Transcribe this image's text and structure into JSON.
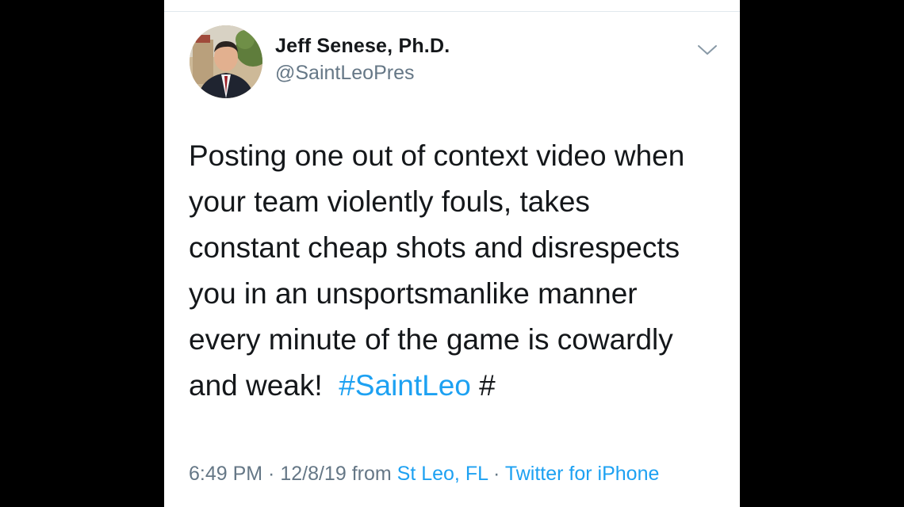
{
  "tweet": {
    "author": {
      "display_name": "Jeff Senese, Ph.D.",
      "handle": "@SaintLeoPres",
      "avatar_icon": "profile-photo"
    },
    "menu_icon": "chevron-down-icon",
    "text_lines": [
      "Posting one out of context video when",
      "your team violently fouls, takes",
      "constant cheap shots and disrespects",
      "you in an unsportsmanlike manner",
      "every minute of the game is cowardly"
    ],
    "last_line": {
      "text": "and weak!  ",
      "hashtag_1": "#SaintLeo",
      "hashtag_2": " #"
    },
    "meta": {
      "time": "6:49 PM",
      "sep1": " · ",
      "date": "12/8/19",
      "from": " from ",
      "location": "St Leo, FL",
      "sep2": " · ",
      "source": "Twitter for iPhone"
    }
  },
  "colors": {
    "background": "#000000",
    "card": "#ffffff",
    "text": "#14171a",
    "secondary": "#657786",
    "link": "#1da1f2"
  }
}
